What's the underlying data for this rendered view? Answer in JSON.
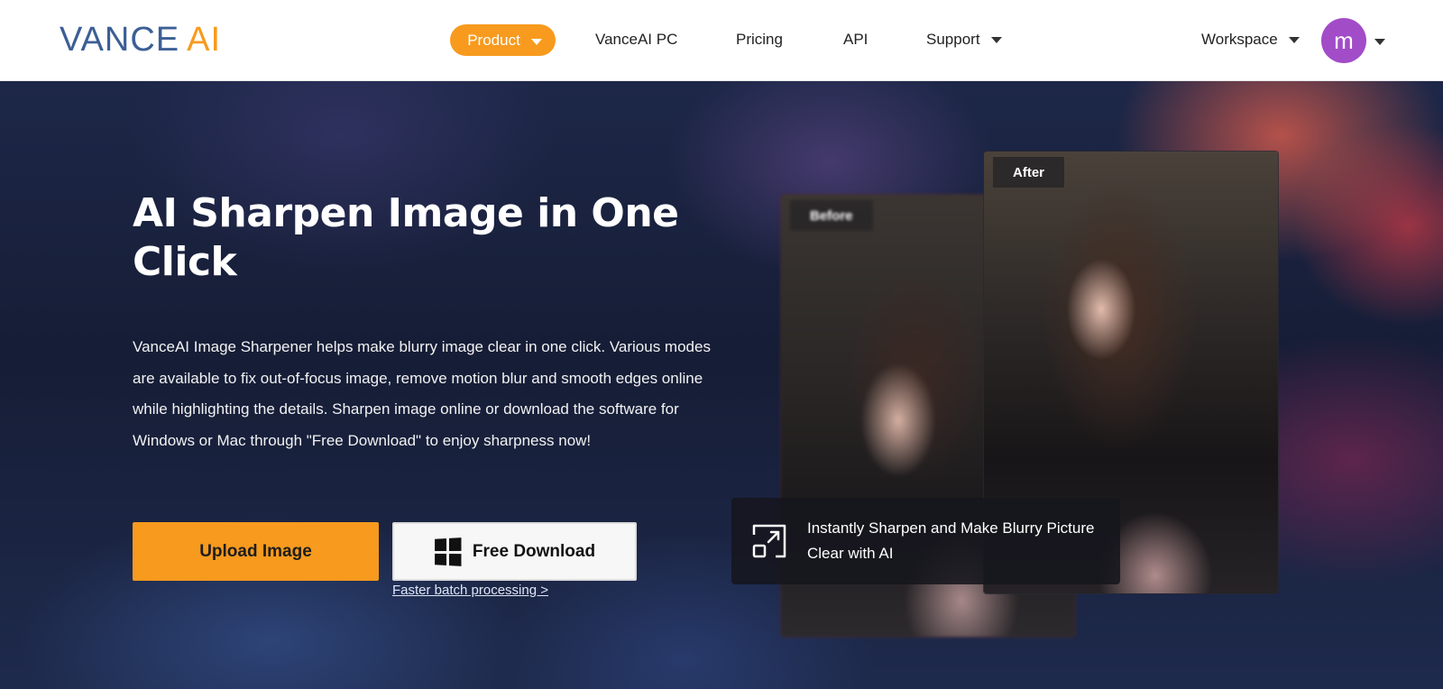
{
  "nav": {
    "logo_vance": "VANCE",
    "logo_ai": "AI",
    "items": [
      {
        "label": "Product"
      },
      {
        "label": "VanceAI PC"
      },
      {
        "label": "Pricing"
      },
      {
        "label": "API"
      },
      {
        "label": "Support"
      }
    ],
    "workspace": "Workspace",
    "avatar_letter": "m"
  },
  "hero": {
    "title": "AI Sharpen Image in One Click",
    "description": "VanceAI Image Sharpener helps make blurry image clear in one click. Various modes are available to fix out-of-focus image, remove motion blur and smooth edges online while highlighting the details. Sharpen image online or download the software for Windows or Mac through \"Free Download\" to enjoy sharpness now!",
    "upload_label": "Upload Image",
    "download_label": "Free Download",
    "batch_link": "Faster batch processing >"
  },
  "compare": {
    "before_label": "Before",
    "after_label": "After",
    "feature_text": "Instantly Sharpen and Make Blurry Picture Clear with AI"
  },
  "colors": {
    "accent": "#f79a1e",
    "logo_blue": "#3c5f95",
    "avatar": "#a24cc8"
  }
}
